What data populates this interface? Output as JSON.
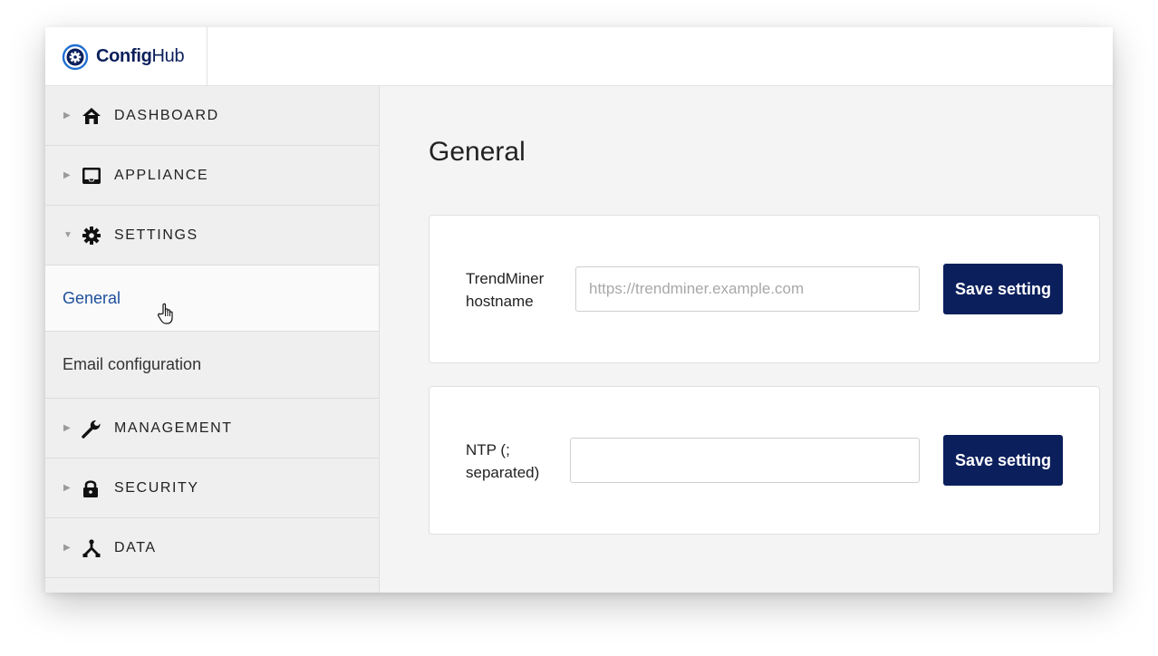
{
  "app": {
    "name_strong": "Config",
    "name_light": "Hub",
    "brand_color": "#0b1f5c",
    "logo_icon": "gear-logo-icon"
  },
  "sidebar": {
    "top_items": [
      {
        "label": "DASHBOARD",
        "icon": "home-icon",
        "caret": "caret-right-icon"
      },
      {
        "label": "APPLIANCE",
        "icon": "inbox-icon",
        "caret": "caret-right-icon"
      },
      {
        "label": "SETTINGS",
        "icon": "gear-icon",
        "caret": "caret-down-icon",
        "expanded": true
      }
    ],
    "sub_items": [
      {
        "label": "General",
        "active": true
      },
      {
        "label": "Email configuration",
        "active": false
      }
    ],
    "bottom_items": [
      {
        "label": "MANAGEMENT",
        "icon": "wrench-icon",
        "caret": "caret-right-icon"
      },
      {
        "label": "SECURITY",
        "icon": "lock-icon",
        "caret": "caret-right-icon"
      },
      {
        "label": "DATA",
        "icon": "data-fork-icon",
        "caret": "caret-right-icon"
      }
    ],
    "active_color": "#1d4f9c"
  },
  "main": {
    "title": "General",
    "cards": [
      {
        "label_line1": "TrendMiner",
        "label_line2": "hostname",
        "input_value": "",
        "input_placeholder": "https://trendminer.example.com",
        "button_label": "Save setting"
      },
      {
        "label_line1": "NTP (;",
        "label_line2": "separated)",
        "input_value": "",
        "input_placeholder": "",
        "button_label": "Save setting"
      }
    ]
  }
}
